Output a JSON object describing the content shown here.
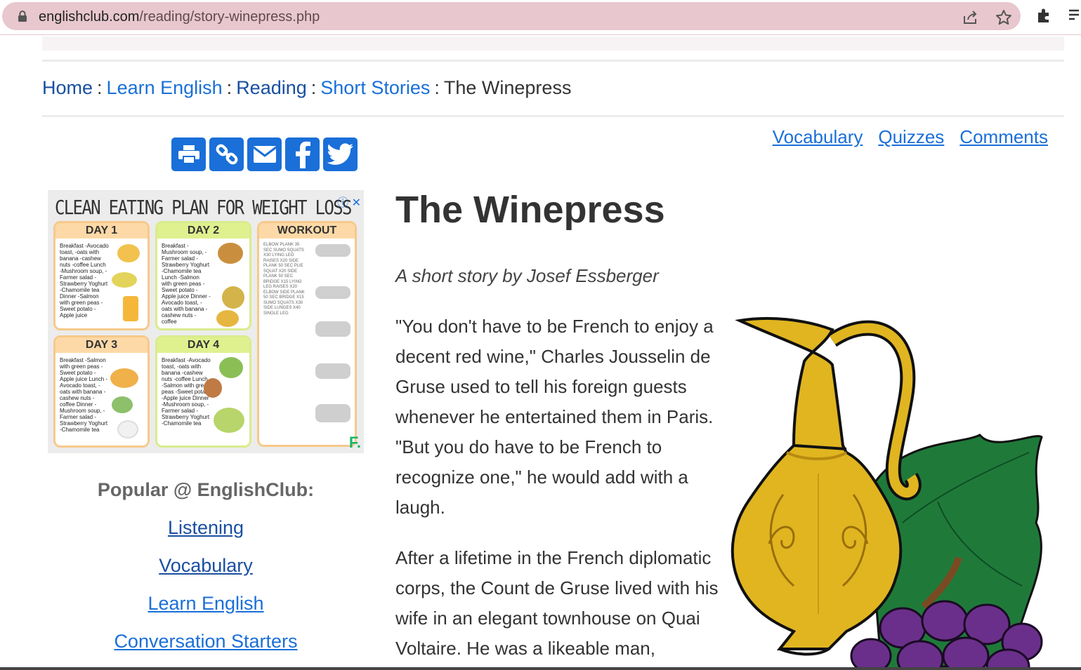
{
  "browser": {
    "url_host": "englishclub.com",
    "url_path": "/reading/story-winepress.php",
    "icons": [
      "lock-icon",
      "share-icon",
      "star-icon",
      "extensions-icon",
      "reading-list-icon"
    ]
  },
  "breadcrumb": {
    "items": [
      "Home",
      "Learn English",
      "Reading",
      "Short Stories"
    ],
    "current": "The Winepress",
    "separator": ":"
  },
  "share_buttons": [
    "print-icon",
    "copy-link-icon",
    "email-icon",
    "facebook-icon",
    "twitter-icon"
  ],
  "tab_links": [
    "Vocabulary",
    "Quizzes",
    "Comments"
  ],
  "ad": {
    "title": "CLEAN EATING PLAN FOR WEIGHT LOSS",
    "cards": [
      {
        "head": "DAY 1",
        "text": "Breakfast -Avocado toast, -oats with banana -cashew nuts -coffee Lunch -Mushroom soup, -Farmer salad -Strawberry Yoghurt -Chamomile tea Dinner -Salmon with green peas -Sweet potato -Apple juice"
      },
      {
        "head": "DAY 2",
        "text": "Breakfast -Mushroom soup, -Farmer salad -Strawberry Yoghurt -Chamomile tea Lunch -Salmon with green peas -Sweet potato -Apple juice Dinner -Avocado toast, -oats with banana -cashew nuts -coffee"
      },
      {
        "head": "WORKOUT",
        "text": "ELBOW PLANK 35 SEC SUMO SQUATS X30 LYING LEG RAISES X20 SIDE PLANK 50 SEC PLIE SQUAT X20 SIDE PLANK 50 SEC BRIDGE X15 LYING LEG RAISES X20 ELBOW SIDE PLANK 50 SEC BRIDGE X15 SUMO SQUATS X30 SIDE LUNGES X40 SINGLE LEG"
      },
      {
        "head": "DAY 3",
        "text": "Breakfast -Salmon with green peas -Sweet potato -Apple juice Lunch -Avocado toast, -oats with banana -cashew nuts -coffee Dinner -Mushroom soup, -Farmer salad -Strawberry Yoghurt -Chamomile tea"
      },
      {
        "head": "DAY 4",
        "text": "Breakfast -Avocado toast, -oats with banana -cashew nuts -coffee Lunch -Salmon with green peas -Sweet potato -Apple juice Dinner -Mushroom soup, -Farmer salad -Strawberry Yoghurt -Chamomile tea"
      }
    ],
    "logo": "F."
  },
  "popular": {
    "title": "Popular @ EnglishClub:",
    "links": [
      "Listening",
      "Vocabulary",
      "Learn English",
      "Conversation Starters"
    ]
  },
  "article": {
    "title": "The Winepress",
    "byline": "A short story by Josef Essberger",
    "paragraphs": [
      "\"You don't have to be French to enjoy a decent red wine,\" Charles Jousselin de Gruse used to tell his foreign guests whenever he entertained them in Paris. \"But you do have to be French to recognize one,\" he would add with a laugh.",
      "After a lifetime in the French diplomatic corps, the Count de Gruse lived with his wife in an elegant townhouse on Quai Voltaire. He was a likeable man,"
    ]
  },
  "colors": {
    "link": "#1a6fd8",
    "link_dark": "#1a4fa0",
    "share_button": "#1a6fd8",
    "omnibox": "#e8c7cf"
  }
}
